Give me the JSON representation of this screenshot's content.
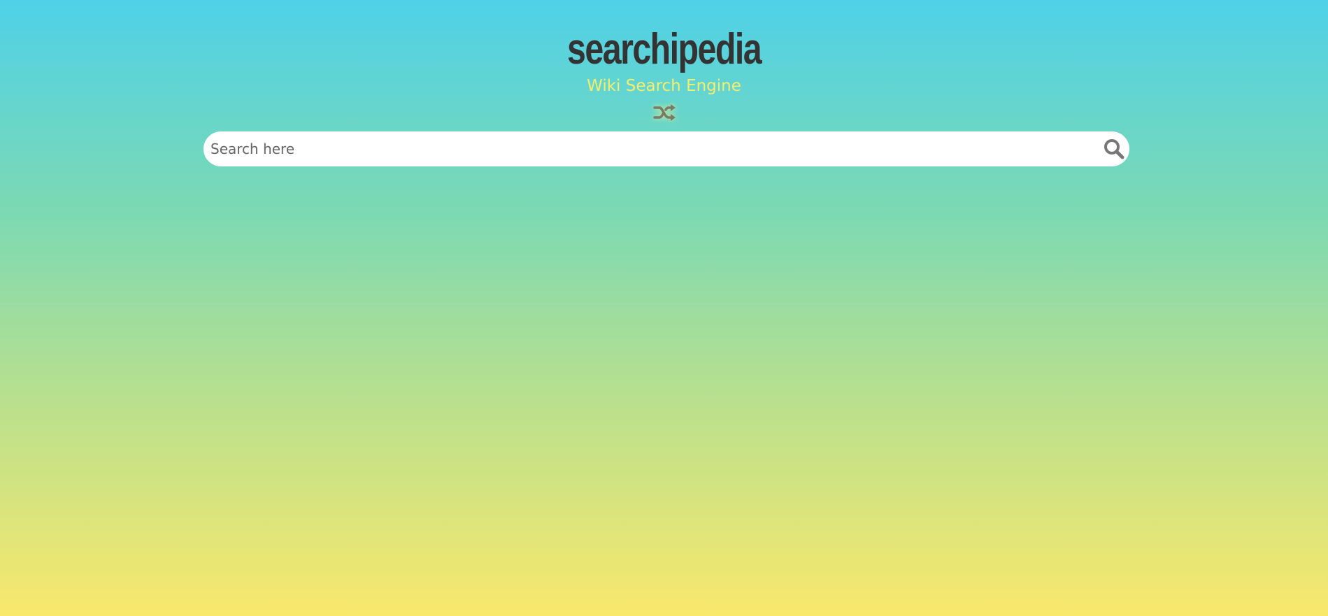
{
  "app": {
    "logo": "searchipedia",
    "subtitle": "Wiki Search Engine"
  },
  "random_button": {
    "icon": "shuffle-icon",
    "color": "#7a7a6a"
  },
  "search": {
    "placeholder": "Search here",
    "value": "",
    "submit_icon": "search-icon"
  },
  "colors": {
    "background_top": "#4fd1e8",
    "background_bottom": "#f9e86c",
    "logo_text": "#333333",
    "subtitle_text": "#f5ee6a"
  }
}
